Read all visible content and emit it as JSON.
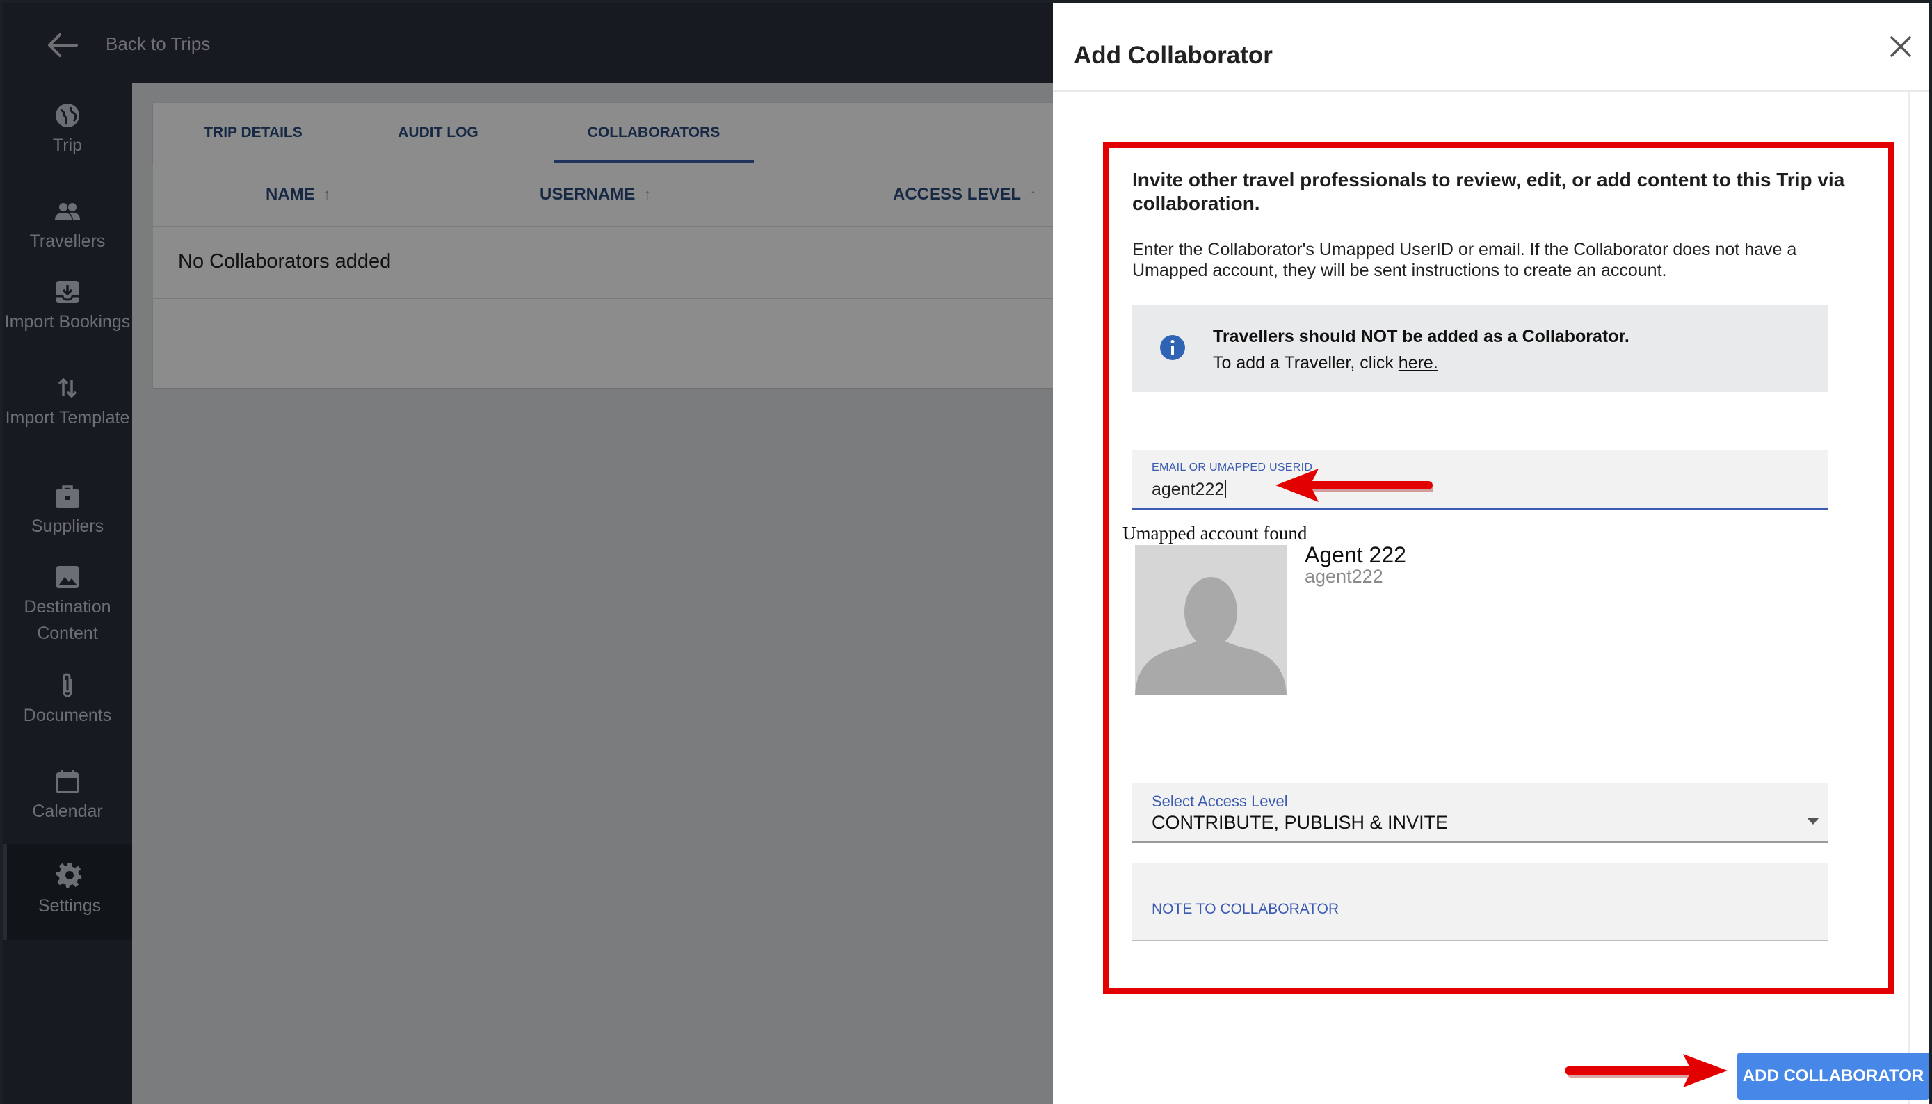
{
  "topbar": {
    "back_label": "Back to Trips"
  },
  "sidebar": {
    "items": [
      {
        "label": "Trip",
        "icon": "globe-icon"
      },
      {
        "label": "Travellers",
        "icon": "people-icon"
      },
      {
        "label": "Import Bookings",
        "icon": "inbox-download-icon"
      },
      {
        "label": "Import Template",
        "icon": "swap-vertical-icon"
      },
      {
        "label": "Suppliers",
        "icon": "briefcase-icon"
      },
      {
        "label": "Destination Content",
        "icon": "image-icon"
      },
      {
        "label": "Documents",
        "icon": "paperclip-icon"
      },
      {
        "label": "Calendar",
        "icon": "calendar-icon"
      },
      {
        "label": "Settings",
        "icon": "gear-icon",
        "active": true
      }
    ]
  },
  "main": {
    "tabs": [
      {
        "label": "TRIP DETAILS"
      },
      {
        "label": "AUDIT LOG"
      },
      {
        "label": "COLLABORATORS",
        "active": true
      }
    ],
    "table": {
      "columns": [
        "NAME",
        "USERNAME",
        "ACCESS LEVEL"
      ],
      "sort_glyph": "↑",
      "empty_text": "No Collaborators added"
    }
  },
  "modal": {
    "title": "Add Collaborator",
    "intro_strong": "Invite other travel professionals to review, edit, or add content to this Trip via collaboration.",
    "intro_text": "Enter the Collaborator's Umapped UserID or email. If the Collaborator does not have a Umapped account, they will be sent instructions to create an account.",
    "info": {
      "strong": "Travellers should NOT be added as a Collaborator.",
      "line_prefix": "To add a Traveller, click ",
      "link": "here."
    },
    "email_field": {
      "label": "EMAIL OR UMAPPED USERID",
      "value": "agent222"
    },
    "found_label": "Umapped account found",
    "account": {
      "name": "Agent 222",
      "username": "agent222"
    },
    "access_select": {
      "label": "Select Access Level",
      "value": "CONTRIBUTE, PUBLISH & INVITE"
    },
    "note_field": {
      "label": "NOTE TO COLLABORATOR"
    },
    "add_button": "ADD COLLABORATOR"
  },
  "colors": {
    "sidebar_bg": "#2b313b",
    "accent_blue": "#3b5bb0",
    "button_blue": "#4787e8",
    "annotation_red": "#e20000"
  }
}
